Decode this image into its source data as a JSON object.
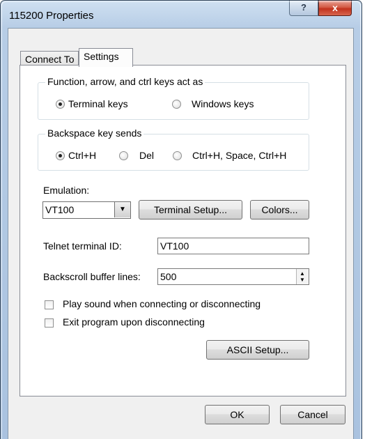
{
  "window": {
    "title": "115200 Properties",
    "help_glyph": "?",
    "close_glyph": "x"
  },
  "tabs": [
    {
      "label": "Connect To"
    },
    {
      "label": "Settings"
    }
  ],
  "keys_group": {
    "legend": "Function, arrow, and ctrl keys act as",
    "options": [
      {
        "label": "Terminal keys",
        "selected": true
      },
      {
        "label": "Windows keys",
        "selected": false
      }
    ]
  },
  "backspace_group": {
    "legend": "Backspace key sends",
    "options": [
      {
        "label": "Ctrl+H",
        "selected": true
      },
      {
        "label": "Del",
        "selected": false
      },
      {
        "label": "Ctrl+H, Space, Ctrl+H",
        "selected": false
      }
    ]
  },
  "emulation": {
    "label": "Emulation:",
    "value": "VT100",
    "terminal_setup_button": "Terminal Setup...",
    "colors_button": "Colors..."
  },
  "telnet": {
    "label": "Telnet terminal ID:",
    "value": "VT100"
  },
  "backscroll": {
    "label": "Backscroll buffer lines:",
    "value": "500"
  },
  "checkboxes": [
    {
      "label": "Play sound when connecting or disconnecting",
      "checked": false
    },
    {
      "label": "Exit program upon disconnecting",
      "checked": false
    }
  ],
  "ascii_setup_button": "ASCII Setup...",
  "footer": {
    "ok": "OK",
    "cancel": "Cancel"
  }
}
